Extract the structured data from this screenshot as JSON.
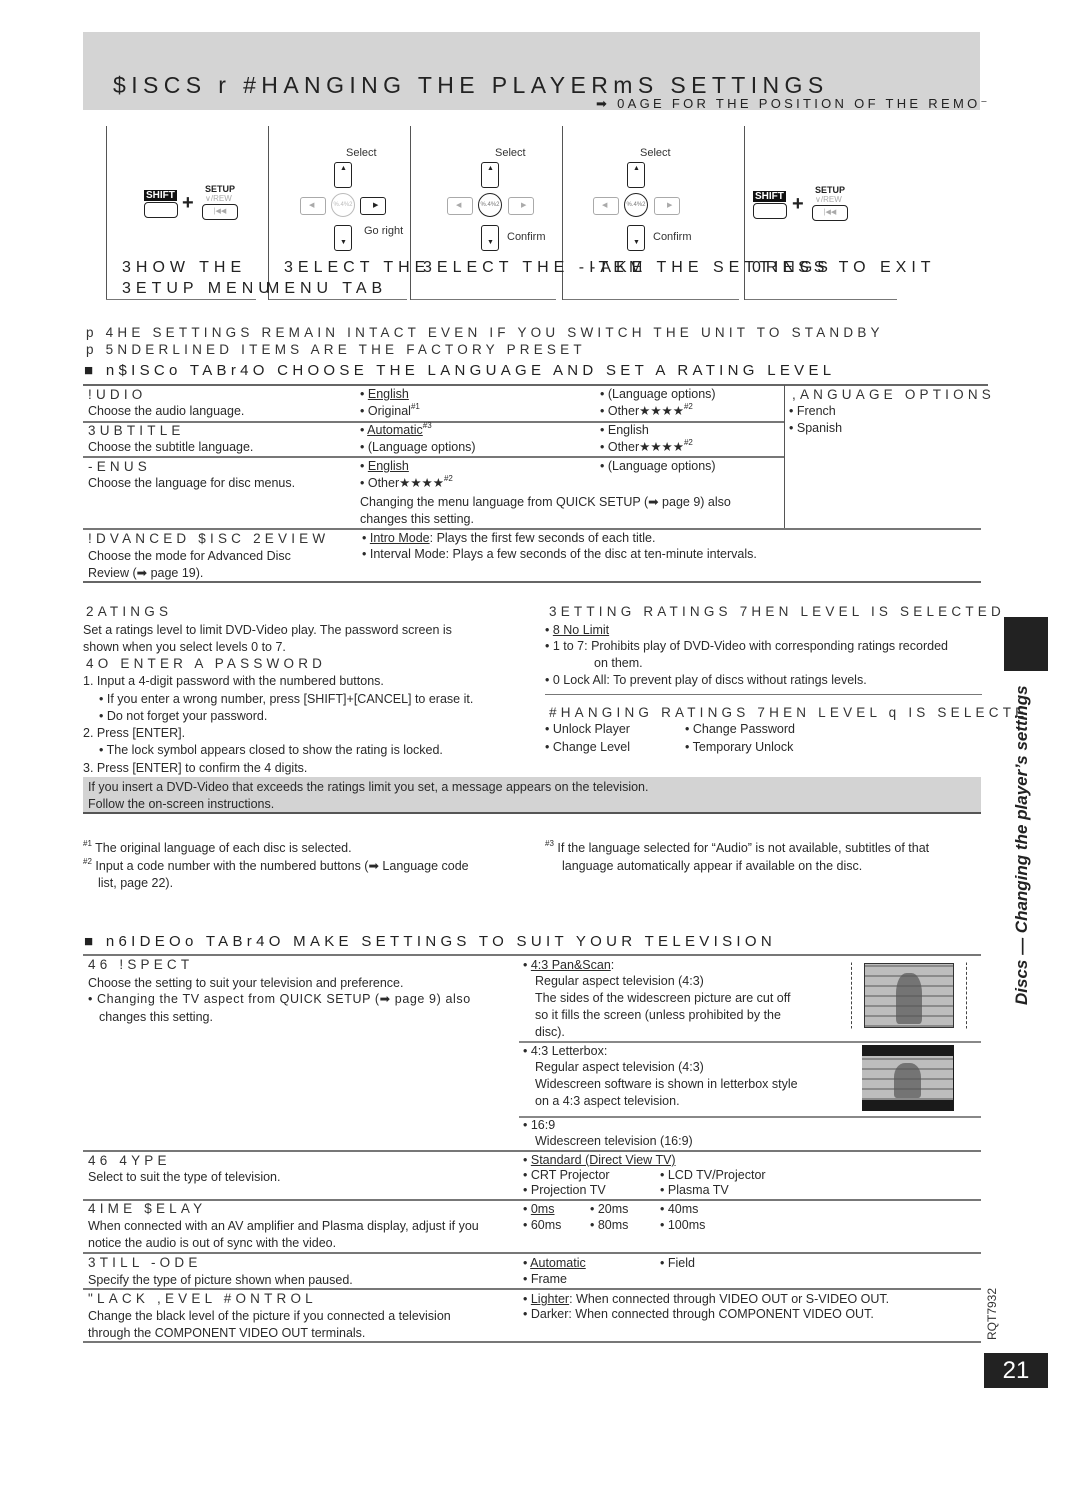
{
  "header": {
    "title": "$ISCS r #HANGING THE PLAYERmS SETTINGS",
    "remote_note": "➡ 0AGE   FOR THE POSITION OF THE REMO⁻"
  },
  "steps": [
    {
      "caption_line1": "3HOW THE",
      "caption_line2": "3ETUP MENU",
      "shift": "SHIFT",
      "setup": "SETUP",
      "rew": "∨/REW",
      "rew_glyph": "|◀◀"
    },
    {
      "caption_line1": "3ELECT THE",
      "caption_line2": "MENU TAB",
      "select": "Select",
      "action": "Go right",
      "enter": "%.4%2"
    },
    {
      "caption_line1": "3ELECT THE -ITEM",
      "select": "Select",
      "action": "Confirm",
      "enter": "%.4%2"
    },
    {
      "caption_line1": "-AKE THE SETTINGS",
      "select": "Select",
      "action": "Confirm",
      "enter": "%.4%2"
    },
    {
      "caption_line1": "0RESS TO EXIT",
      "shift": "SHIFT",
      "setup": "SETUP",
      "rew": "∨/REW",
      "rew_glyph": "|◀◀"
    }
  ],
  "notes": [
    "p 4HE SETTINGS REMAIN INTACT EVEN IF YOU SWITCH THE UNIT TO STANDBY",
    "p 5NDERLINED ITEMS ARE THE FACTORY PRESET"
  ],
  "disc_section": {
    "heading": "■ n$ISCo TABr4O CHOOSE THE LANGUAGE AND SET A RATING LEVEL",
    "audio": {
      "title": "!UDIO",
      "desc": "Choose the audio language.",
      "opt1": "English",
      "opt2": "Original",
      "opt2_sup": "#1",
      "opt3": "(Language options)",
      "opt4": "Other★★★★",
      "opt4_sup": "#2"
    },
    "subtitle": {
      "title": "3UBTITLE",
      "desc": "Choose the subtitle language.",
      "opt1": "Automatic",
      "opt1_sup": "#3",
      "opt2": "(Language options)",
      "opt3": "English",
      "opt4": "Other★★★★",
      "opt4_sup": "#2"
    },
    "menus": {
      "title": "-ENUS",
      "desc": "Choose the language for disc menus.",
      "opt1": "English",
      "opt2": "Other★★★★",
      "opt2_sup": "#2",
      "opt3": "(Language options)",
      "note1": "Changing the menu language from QUICK SETUP (➡ page 9) also",
      "note2": "changes this setting."
    },
    "language_options": {
      "title": ",ANGUAGE OPTIONS",
      "items": [
        "French",
        "Spanish"
      ]
    },
    "adr": {
      "title": "!DVANCED $ISC 2EVIEW",
      "desc1": "Choose the mode for Advanced Disc",
      "desc2": "Review (➡ page 19).",
      "opt1_name": "Intro Mode",
      "opt1_text": ": Plays the first few seconds of each title.",
      "opt2": "Interval Mode: Plays a few seconds of the disc at ten-minute intervals."
    },
    "ratings": {
      "title": "2ATINGS",
      "desc1": "Set a ratings level to limit DVD-Video play. The password screen is",
      "desc2": "shown when you select levels 0 to 7.",
      "pw_title": "4O ENTER A PASSWORD",
      "steps": [
        "1. Input a 4-digit password with the numbered buttons.",
        "• If you enter a wrong number, press [SHIFT]+[CANCEL] to erase it.",
        "• Do not forget your password.",
        "2. Press [ENTER].",
        "• The lock symbol appears closed to show the rating is locked.",
        "3. Press [ENTER] to confirm the 4 digits."
      ],
      "setting_title": "3ETTING RATINGS  7HEN LEVEL   IS SELECTED",
      "setting_opt1": "8 No Limit",
      "setting_opt2a": "1 to 7: Prohibits play of DVD-Video with corresponding ratings recorded",
      "setting_opt2b": "on them.",
      "setting_opt3": "0 Lock All: To prevent play of discs without ratings levels.",
      "changing_title": "#HANGING RATINGS  7HEN LEVEL   q   IS SELECTE",
      "changing_opts": [
        "Unlock Player",
        "Change Password",
        "Change Level",
        "Temporary Unlock"
      ],
      "notice1": "If you insert a DVD-Video that exceeds the ratings limit you set, a message appears on the television.",
      "notice2": "Follow the on-screen instructions."
    },
    "footnotes": {
      "f1_mark": "#1",
      "f1": "The original language of each disc is selected.",
      "f2_mark": "#2",
      "f2a": "Input a code number with the numbered buttons (➡ Language code",
      "f2b": "list, page 22).",
      "f3_mark": "#3",
      "f3a": "If the language selected for “Audio” is not available, subtitles of that",
      "f3b": "language automatically appear if available on the disc."
    }
  },
  "video_section": {
    "heading": "■ n6IDEOo TABr4O MAKE SETTINGS TO SUIT YOUR TELEVISION",
    "aspect": {
      "title": "46 !SPECT",
      "desc": "Choose the setting to suit your television and preference.",
      "note1": "• Changing the TV aspect from QUICK SETUP (➡ page 9) also",
      "note2": "changes this setting.",
      "panscan": {
        "name": "4:3 Pan&Scan",
        "l1": "Regular aspect television (4:3)",
        "l2": "The sides of the widescreen picture are cut off",
        "l3": "so it fills the screen (unless prohibited by the",
        "l4": "disc)."
      },
      "letterbox": {
        "name": "4:3 Letterbox:",
        "l1": "Regular aspect television (4:3)",
        "l2": "Widescreen software is shown in letterbox style",
        "l3": "on a 4:3 aspect television."
      },
      "wide": {
        "name": "16:9",
        "l1": "Widescreen television (16:9)"
      }
    },
    "tv_type": {
      "title": "46 4YPE",
      "desc": "Select to suit the type of television.",
      "opts": [
        "Standard (Direct View TV)",
        "CRT Projector",
        "LCD TV/Projector",
        "Projection TV",
        "Plasma TV"
      ]
    },
    "time_delay": {
      "title": "4IME $ELAY",
      "desc1": "When connected with an AV amplifier and Plasma display, adjust if you",
      "desc2": "notice the audio is out of sync with the video.",
      "opts": [
        "0ms",
        "20ms",
        "40ms",
        "60ms",
        "80ms",
        "100ms"
      ]
    },
    "still_mode": {
      "title": "3TILL -ODE",
      "desc": "Specify the type of picture shown when paused.",
      "opts": [
        "Automatic",
        "Field",
        "Frame"
      ]
    },
    "black_level": {
      "title": "\"LACK ,EVEL #ONTROL",
      "desc1": "Change the black level of the picture if you connected a television",
      "desc2": "through the COMPONENT VIDEO OUT terminals.",
      "opt1_name": "Lighter",
      "opt1_text": ": When connected through VIDEO OUT or S-VIDEO OUT.",
      "opt2": "Darker: When connected through COMPONENT VIDEO OUT."
    }
  },
  "side": {
    "tab_text": "Discs — Changing the player’s settings",
    "doc_code": "RQT7932",
    "page_number": "21"
  }
}
